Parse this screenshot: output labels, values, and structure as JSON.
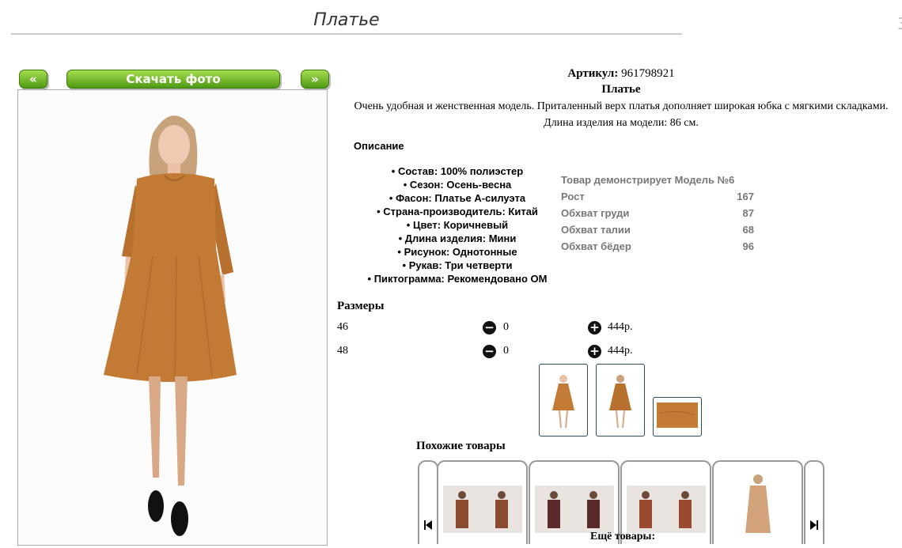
{
  "page": {
    "title": "Платье"
  },
  "photo": {
    "download_label": "Скачать фото",
    "prev_label": "«",
    "next_label": "»"
  },
  "product": {
    "article_label": "Артикул:",
    "article_value": "961798921",
    "name": "Платье",
    "description": "Очень удобная и женственная модель. Приталенный верх платья дополняет широкая юбка с мягкими складками. Длина изделия на модели: 86 см.",
    "description_heading": "Описание",
    "properties": [
      "Состав: 100% полиэстер",
      "Сезон: Осень-весна",
      "Фасон: Платье А-силуэта",
      "Страна-производитель: Китай",
      "Цвет: Коричневый",
      "Длина изделия: Мини",
      "Рисунок: Однотонные",
      "Рукав: Три четверти",
      "Пиктограмма: Рекомендовано ОМ"
    ]
  },
  "model": {
    "heading": "Товар демонстрирует Модель №6",
    "rows": [
      {
        "label": "Рост",
        "value": "167"
      },
      {
        "label": "Обхват груди",
        "value": "87"
      },
      {
        "label": "Обхват талии",
        "value": "68"
      },
      {
        "label": "Обхват бёдер",
        "value": "96"
      }
    ]
  },
  "sizes": {
    "heading": "Размеры",
    "rows": [
      {
        "size": "46",
        "qty": "0",
        "price": "444р."
      },
      {
        "size": "48",
        "qty": "0",
        "price": "444р."
      }
    ]
  },
  "similar": {
    "heading": "Похожие товары"
  },
  "more": {
    "label": "Ещё товары:"
  },
  "icons": {
    "minus": "minus-circle-icon",
    "plus": "plus-circle-icon",
    "first": "skip-first-icon",
    "last": "skip-last-icon"
  },
  "colors": {
    "accent_green": "#4f9a14",
    "dress_brown": "#c27a35"
  }
}
